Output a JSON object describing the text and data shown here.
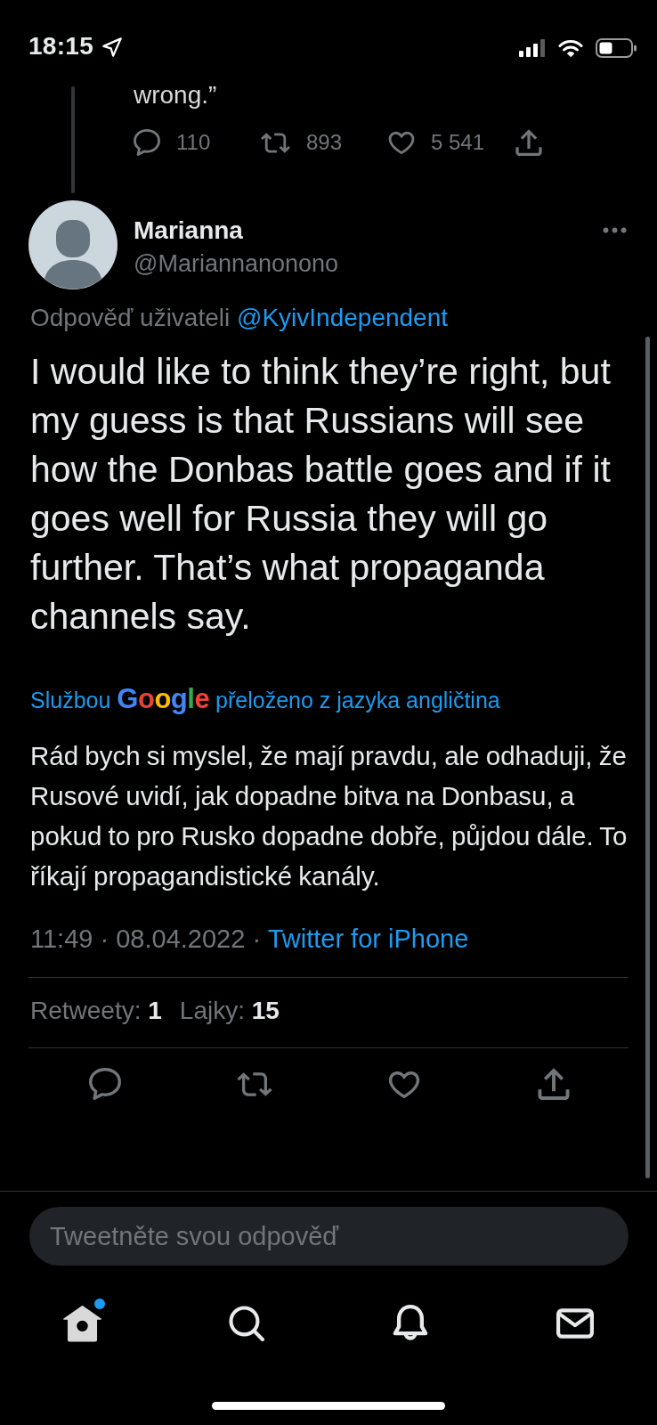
{
  "status_bar": {
    "time": "18:15"
  },
  "parent_tweet": {
    "text": "wrong.”",
    "actions": [
      {
        "kind": "reply",
        "count": "110"
      },
      {
        "kind": "retweet",
        "count": "893"
      },
      {
        "kind": "like",
        "count": "5 541"
      },
      {
        "kind": "share"
      }
    ]
  },
  "tweet": {
    "author": {
      "name": "Marianna",
      "handle": "@Mariannanonono"
    },
    "reply_context": {
      "text": "Odpověď uživateli",
      "mention": "@KyivIndependent"
    },
    "text": "I would like to think they’re right, but my guess is that Russians will see how the Donbas battle goes and if it goes well for Russia they will go further. That’s what propaganda channels say.",
    "translation": {
      "prefix": "Službou",
      "service": "Google",
      "suffix": "přeloženo z jazyka angličtina"
    },
    "translated_text": "Rád bych si myslel, že mají pravdu, ale odhaduji, že Rusové uvidí, jak dopadne bitva na Donbasu, a pokud to pro Rusko dopadne dobře, půjdou dále. To říkají propagandistické kanály.",
    "meta": {
      "time": "11:49",
      "separator": "·",
      "date": "08.04.2022",
      "source": "Twitter for iPhone"
    },
    "stats": [
      "Retweety: **1**",
      "Lajky: **15**"
    ],
    "actions": [
      {
        "kind": "reply"
      },
      {
        "kind": "retweet"
      },
      {
        "kind": "like"
      },
      {
        "kind": "share"
      }
    ]
  },
  "reply_field": {
    "placeholder": "Tweetněte svou odpověď"
  },
  "tab_bar": [
    {
      "kind": "home",
      "selected": true,
      "dot": true
    },
    {
      "kind": "search",
      "selected": false,
      "dot": false
    },
    {
      "kind": "notifications",
      "selected": false,
      "dot": false
    },
    {
      "kind": "messages",
      "selected": false,
      "dot": false
    }
  ]
}
